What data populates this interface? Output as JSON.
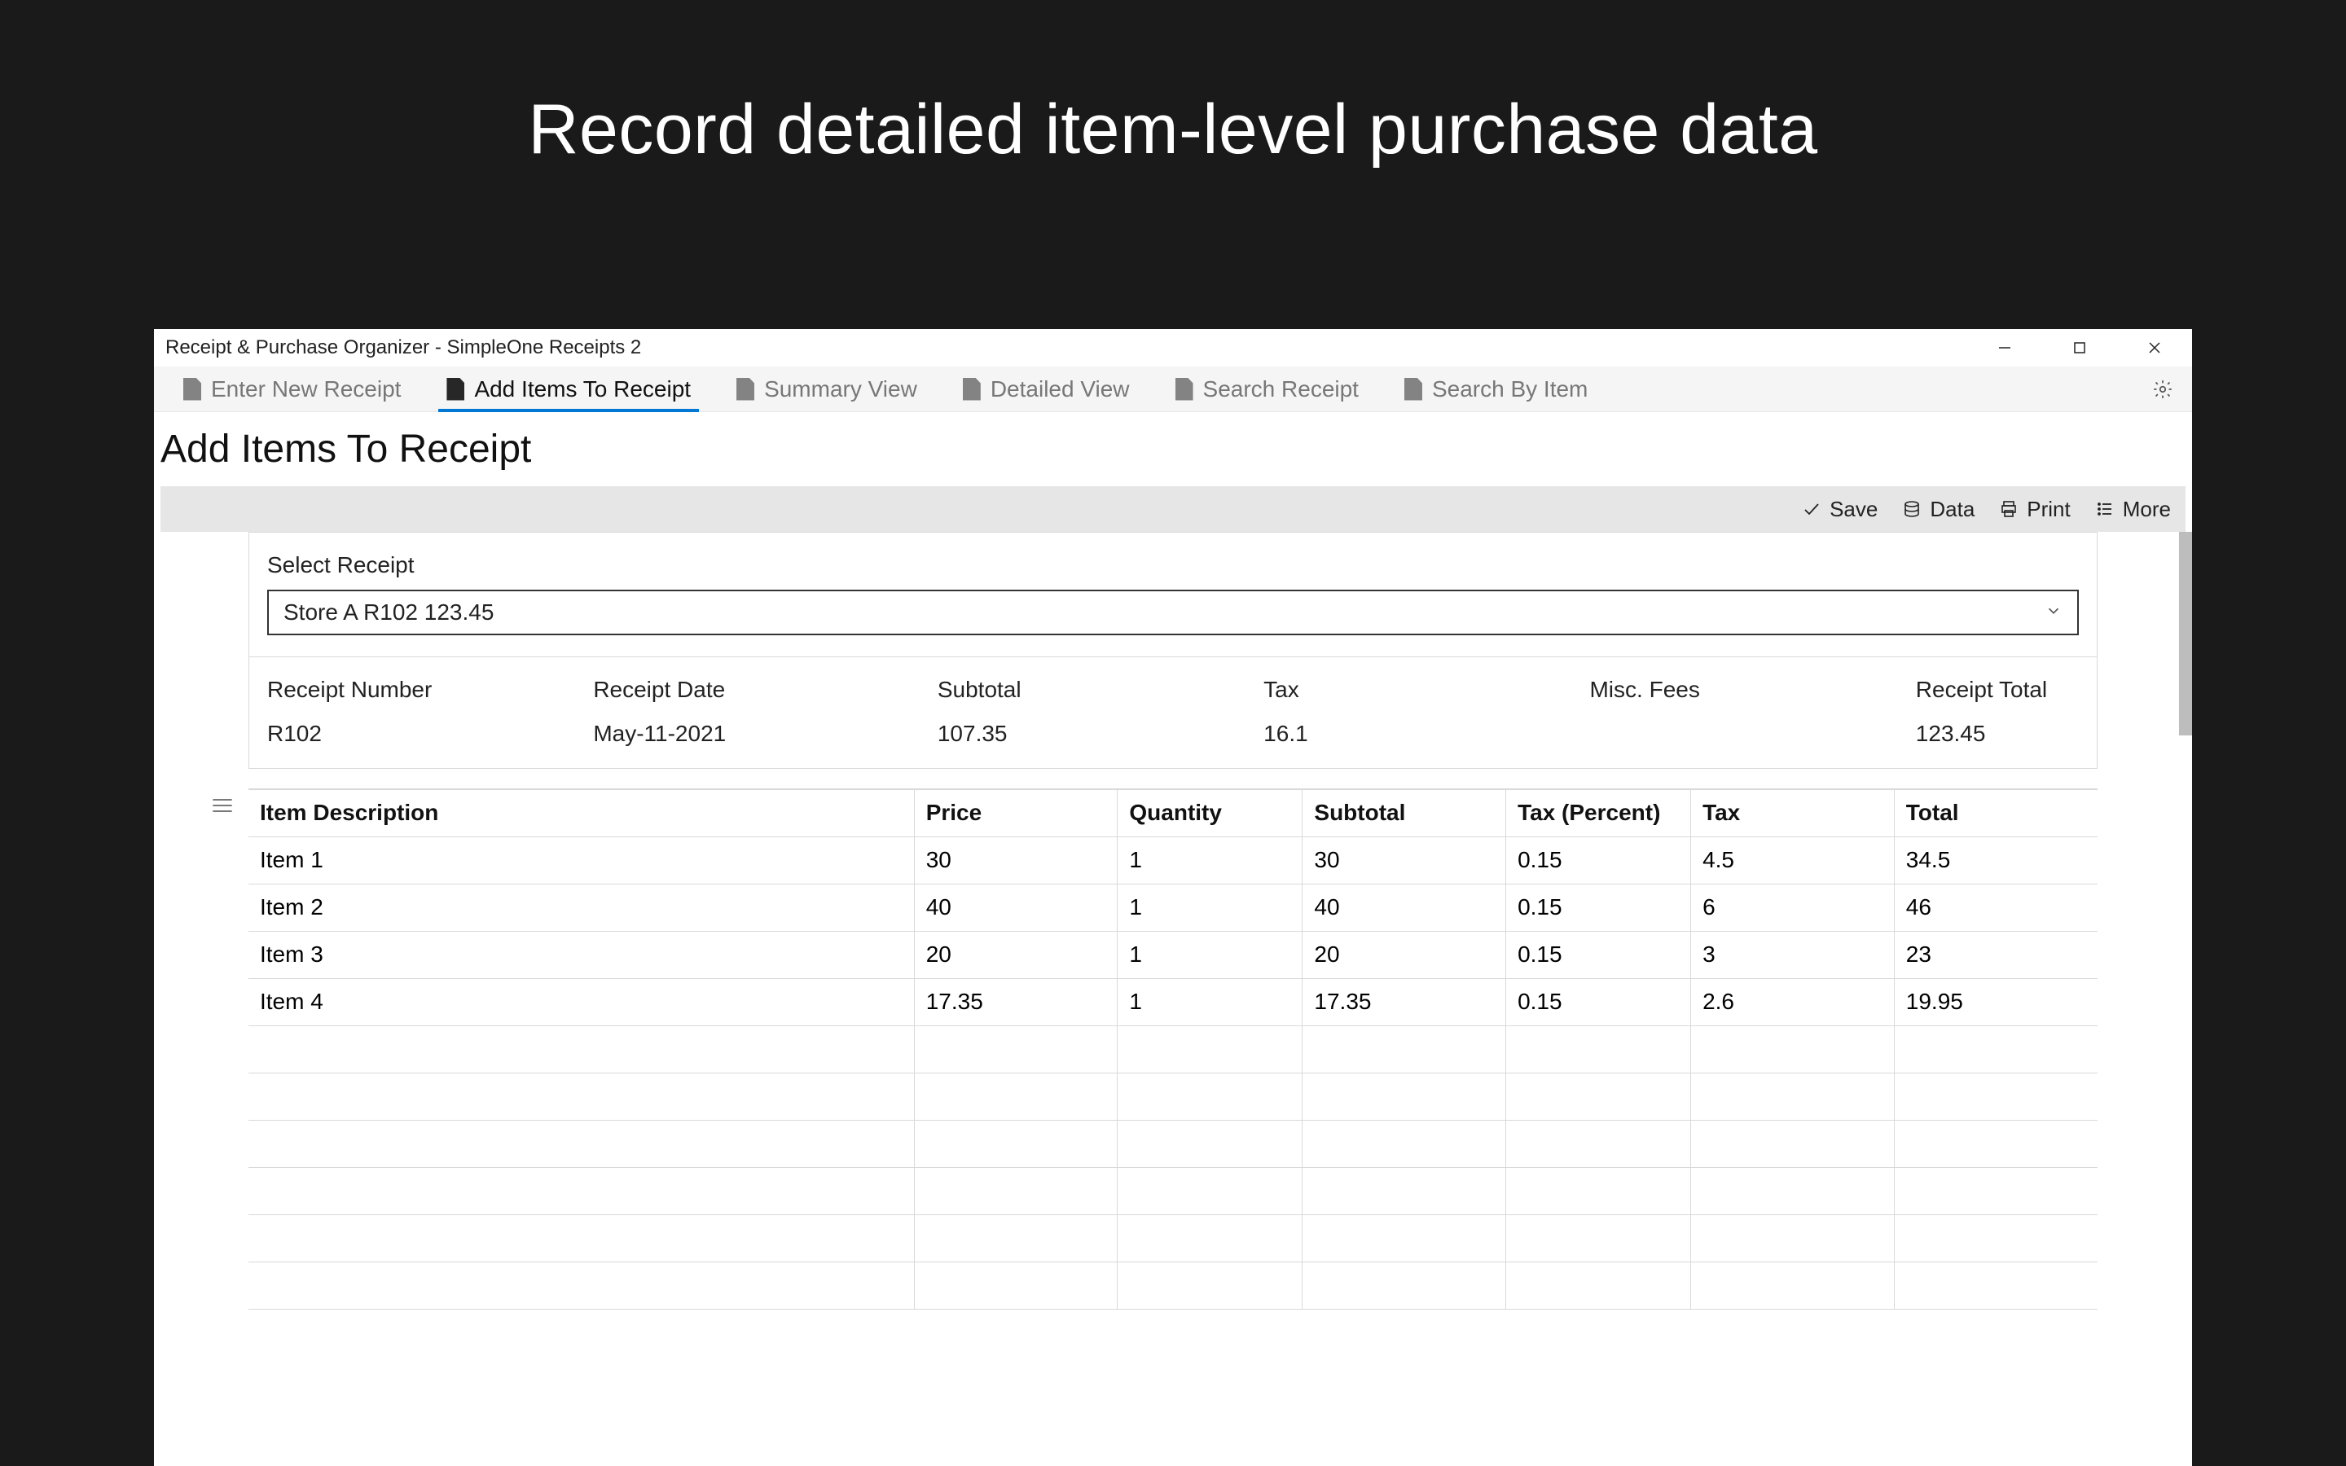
{
  "promo": {
    "headline": "Record detailed item-level purchase data"
  },
  "window": {
    "title": "Receipt & Purchase Organizer - SimpleOne Receipts 2"
  },
  "tabs": [
    {
      "label": "Enter New Receipt"
    },
    {
      "label": "Add Items To Receipt"
    },
    {
      "label": "Summary View"
    },
    {
      "label": "Detailed View"
    },
    {
      "label": "Search Receipt"
    },
    {
      "label": "Search By Item"
    }
  ],
  "active_tab_index": 1,
  "page": {
    "heading": "Add Items To Receipt"
  },
  "actions": {
    "save": "Save",
    "data": "Data",
    "print": "Print",
    "more": "More"
  },
  "select": {
    "label": "Select Receipt",
    "value": "Store A R102 123.45"
  },
  "summary": {
    "receipt_number_label": "Receipt Number",
    "receipt_number": "R102",
    "receipt_date_label": "Receipt Date",
    "receipt_date": "May-11-2021",
    "subtotal_label": "Subtotal",
    "subtotal": "107.35",
    "tax_label": "Tax",
    "tax": "16.1",
    "misc_label": "Misc. Fees",
    "misc": "",
    "total_label": "Receipt Total",
    "total": "123.45"
  },
  "items_table": {
    "headers": {
      "description": "Item Description",
      "price": "Price",
      "quantity": "Quantity",
      "subtotal": "Subtotal",
      "tax_percent": "Tax (Percent)",
      "tax": "Tax",
      "total": "Total"
    },
    "rows": [
      {
        "description": "Item 1",
        "price": "30",
        "quantity": "1",
        "subtotal": "30",
        "tax_percent": "0.15",
        "tax": "4.5",
        "total": "34.5"
      },
      {
        "description": "Item 2",
        "price": "40",
        "quantity": "1",
        "subtotal": "40",
        "tax_percent": "0.15",
        "tax": "6",
        "total": "46"
      },
      {
        "description": "Item 3",
        "price": "20",
        "quantity": "1",
        "subtotal": "20",
        "tax_percent": "0.15",
        "tax": "3",
        "total": "23"
      },
      {
        "description": "Item 4",
        "price": "17.35",
        "quantity": "1",
        "subtotal": "17.35",
        "tax_percent": "0.15",
        "tax": "2.6",
        "total": "19.95"
      }
    ],
    "empty_rows": 6
  }
}
